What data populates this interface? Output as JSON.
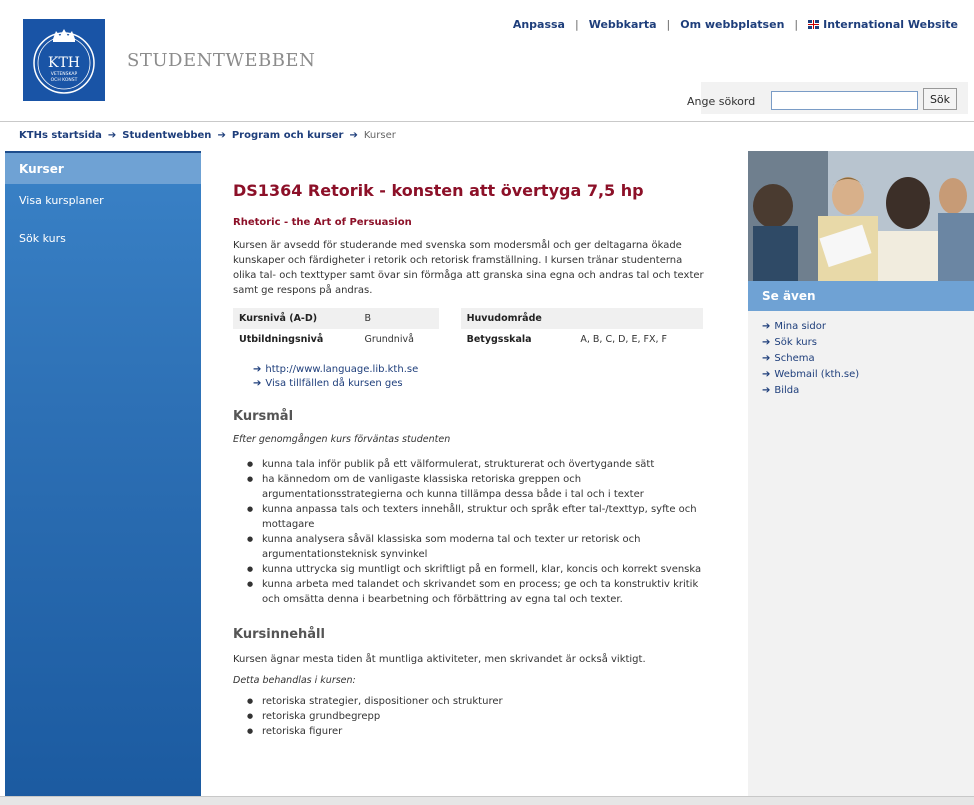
{
  "header": {
    "site_title": "STUDENTWEBBEN",
    "logo_text": "KTH",
    "logo_subtext_1": "VETENSKAP",
    "logo_subtext_2": "OCH KONST",
    "toplinks": [
      "Anpassa",
      "Webbkarta",
      "Om webbplatsen",
      "International Website"
    ],
    "search_label": "Ange sökord",
    "search_value": "",
    "search_button": "Sök"
  },
  "breadcrumb": [
    "KTHs startsida",
    "Studentwebben",
    "Program och kurser",
    "Kurser"
  ],
  "sidebar": {
    "heading": "Kurser",
    "items": [
      "Visa kursplaner",
      "Sök kurs"
    ]
  },
  "course": {
    "title": "DS1364 Retorik - konsten att övertyga 7,5 hp",
    "subtitle": "Rhetoric - the Art of Persuasion",
    "intro": "Kursen är avsedd för studerande med svenska som modersmål och ger deltagarna ökade kunskaper och färdigheter i retorik och retorisk framställning. I kursen tränar studenterna olika tal- och texttyper samt övar sin förmåga att granska sina egna och andras tal och texter samt ge respons på andras.",
    "facts": {
      "kursniva_label": "Kursnivå (A-D)",
      "kursniva_value": "B",
      "huvudomrade_label": "Huvudområde",
      "huvudomrade_value": "",
      "utbildningsniva_label": "Utbildningsnivå",
      "utbildningsniva_value": "Grundnivå",
      "betygsskala_label": "Betygsskala",
      "betygsskala_value": "A, B, C, D, E, FX, F"
    },
    "links": [
      "http://www.language.lib.kth.se",
      "Visa tillfällen då kursen ges"
    ],
    "kursmal": {
      "heading": "Kursmål",
      "lead": "Efter genomgången kurs förväntas studenten",
      "items": [
        "kunna tala inför publik på ett välformulerat, strukturerat och övertygande sätt",
        "ha kännedom om de vanligaste klassiska retoriska greppen och argumentationsstrategierna och kunna tillämpa dessa både i tal och i texter",
        "kunna anpassa tals och texters innehåll, struktur och språk efter tal-/texttyp, syfte och mottagare",
        "kunna analysera såväl klassiska som moderna tal och texter ur retorisk och argumentationsteknisk synvinkel",
        "kunna uttrycka sig muntligt och skriftligt på en formell, klar, koncis och korrekt svenska",
        "kunna arbeta med talandet och skrivandet som en process; ge och ta konstruktiv kritik och omsätta denna i bearbetning och förbättring av egna tal och texter."
      ]
    },
    "kursinnehall": {
      "heading": "Kursinnehåll",
      "text": "Kursen ägnar mesta tiden åt muntliga aktiviteter, men skrivandet är också viktigt.",
      "lead": "Detta behandlas i kursen:",
      "items": [
        "retoriska strategier, dispositioner och strukturer",
        "retoriska grundbegrepp",
        "retoriska figurer"
      ]
    }
  },
  "see_also": {
    "heading": "Se även",
    "items": [
      "Mina sidor",
      "Sök kurs",
      "Schema",
      "Webmail (kth.se)",
      "Bilda"
    ]
  },
  "colors": {
    "kth_blue": "#1954a6",
    "link_blue": "#1e3e7b",
    "title_red": "#8c1028",
    "nav_blue": "#2d70b5"
  },
  "icons": {
    "link_arrow": "arrow-right-icon",
    "flag": "uk-flag-icon",
    "photo": "students-photo"
  }
}
